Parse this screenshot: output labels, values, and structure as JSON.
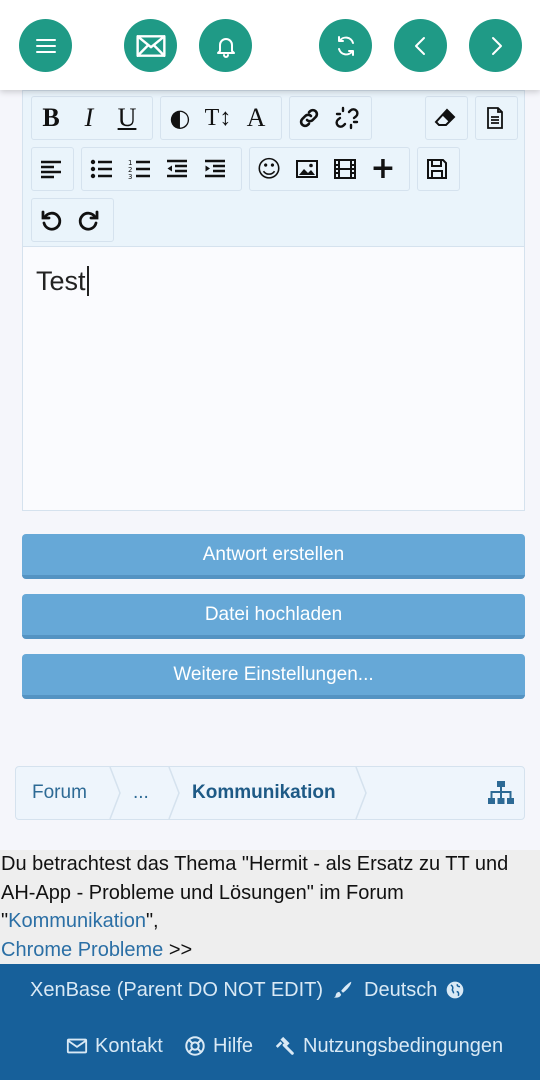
{
  "topbar": {
    "buttons": [
      {
        "name": "menu",
        "icon": "menu-icon"
      },
      {
        "name": "messages",
        "icon": "envelope-icon"
      },
      {
        "name": "alerts",
        "icon": "bell-icon"
      },
      {
        "name": "refresh",
        "icon": "refresh-icon"
      },
      {
        "name": "back",
        "icon": "chevron-left-icon"
      },
      {
        "name": "forward",
        "icon": "chevron-right-icon"
      }
    ],
    "accent_color": "#1f9a86"
  },
  "toolbar": {
    "bold_glyph": "B",
    "italic_glyph": "I",
    "underline_glyph": "U",
    "textcolor_glyph": "◐",
    "fontsize_glyph": "T↕",
    "font_glyph": "A",
    "emoji_glyph": "☺",
    "insert_glyph": "+"
  },
  "editor": {
    "content": "Test"
  },
  "actions": {
    "reply": "Antwort erstellen",
    "upload": "Datei hochladen",
    "more": "Weitere Einstellungen...",
    "button_color": "#66a8d7"
  },
  "breadcrumb": {
    "forum": "Forum",
    "ellipsis": "...",
    "current": "Kommunikation"
  },
  "info": {
    "line_prefix": "Du betrachtest das Thema \"Hermit - als Ersatz zu TT und AH-App - Probleme und Lösungen\" im Forum \"",
    "forum_link": "Kommunikation",
    "line_suffix": "\",",
    "thread_link": "Chrome Probleme",
    "arrows": ">>"
  },
  "footer": {
    "style": "XenBase (Parent DO NOT EDIT)",
    "language": "Deutsch",
    "contact": "Kontakt",
    "help": "Hilfe",
    "terms": "Nutzungsbedingungen",
    "bg_color": "#17609a"
  }
}
